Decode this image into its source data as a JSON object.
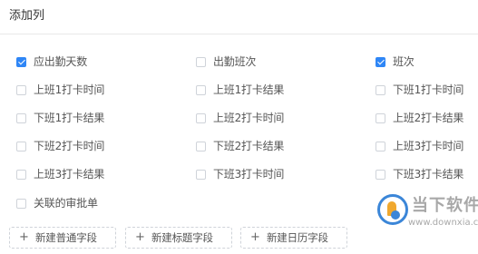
{
  "header": {
    "title": "添加列"
  },
  "options": [
    {
      "label": "应出勤天数",
      "checked": true
    },
    {
      "label": "出勤班次",
      "checked": false
    },
    {
      "label": "班次",
      "checked": true
    },
    {
      "label": "上班1打卡时间",
      "checked": false
    },
    {
      "label": "上班1打卡结果",
      "checked": false
    },
    {
      "label": "下班1打卡时间",
      "checked": false
    },
    {
      "label": "下班1打卡结果",
      "checked": false
    },
    {
      "label": "上班2打卡时间",
      "checked": false
    },
    {
      "label": "上班2打卡结果",
      "checked": false
    },
    {
      "label": "下班2打卡时间",
      "checked": false
    },
    {
      "label": "下班2打卡结果",
      "checked": false
    },
    {
      "label": "上班3打卡时间",
      "checked": false
    },
    {
      "label": "上班3打卡结果",
      "checked": false
    },
    {
      "label": "下班3打卡时间",
      "checked": false
    },
    {
      "label": "下班3打卡结果",
      "checked": false
    },
    {
      "label": "关联的审批单",
      "checked": false
    }
  ],
  "actions": [
    {
      "label": "新建普通字段",
      "icon": "plus-icon"
    },
    {
      "label": "新建标题字段",
      "icon": "plus-icon"
    },
    {
      "label": "新建日历字段",
      "icon": "plus-icon"
    }
  ],
  "watermark": {
    "brand": "当下软件园",
    "url": "www.downxia.com"
  },
  "colors": {
    "accent": "#2f86f6",
    "border": "#e8e8e8",
    "text": "#333333"
  }
}
